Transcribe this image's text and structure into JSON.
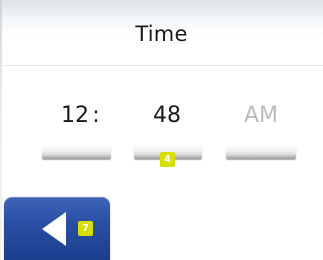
{
  "screen": {
    "title": "Time"
  },
  "time": {
    "hours": "12",
    "separator": ":",
    "minutes": "48",
    "period": "AM"
  },
  "badges": {
    "minutes_slot": "4",
    "back_button": "7"
  },
  "icons": {
    "back": "left-triangle-icon"
  },
  "colors": {
    "accent_badge": "#d6df00",
    "back_button": "#2a4ea3",
    "inactive_text": "#b8bcbf"
  }
}
